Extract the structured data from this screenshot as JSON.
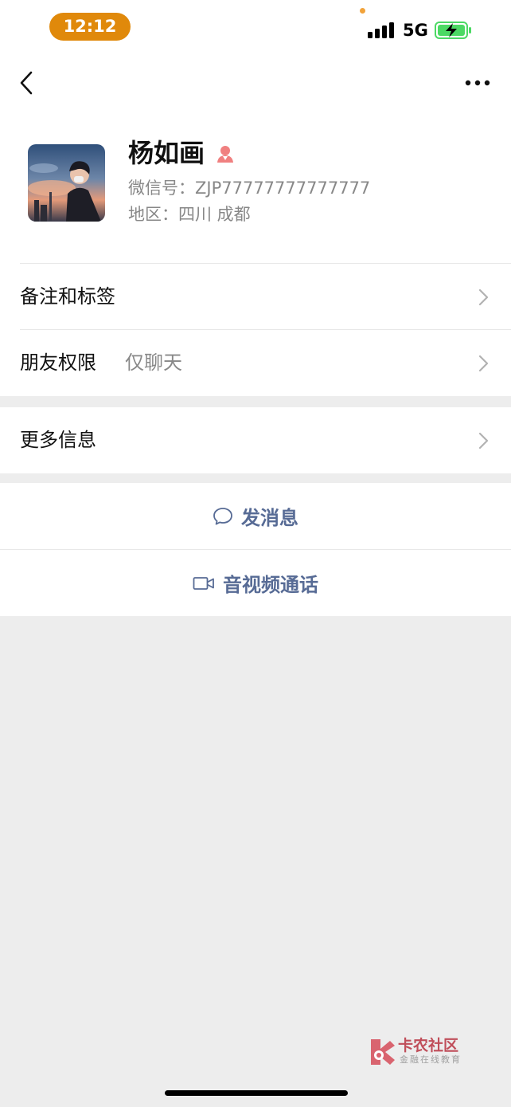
{
  "status_bar": {
    "time": "12:12",
    "network": "5G"
  },
  "profile": {
    "name": "杨如画",
    "wechat_id": "微信号：ZJP77777777777777",
    "region": "地区：四川 成都"
  },
  "rows": {
    "remark_tags": {
      "label": "备注和标签"
    },
    "friend_permissions": {
      "label": "朋友权限",
      "value": "仅聊天"
    },
    "more_info": {
      "label": "更多信息"
    }
  },
  "actions": {
    "send_message": "发消息",
    "video_call": "音视频通话"
  },
  "watermark": {
    "title": "卡农社区",
    "subtitle": "金融在线教育"
  },
  "colors": {
    "link_blue": "#576b95",
    "time_pill": "#e0890b",
    "battery_green": "#4cd964",
    "page_bg": "#ededed",
    "gender_female": "#f08080"
  },
  "icons": {
    "back": "chevron-left-icon",
    "more": "more-dots-icon",
    "gender": "female-icon",
    "row_arrow": "chevron-right-icon",
    "message": "chat-bubble-icon",
    "video": "video-camera-icon"
  }
}
